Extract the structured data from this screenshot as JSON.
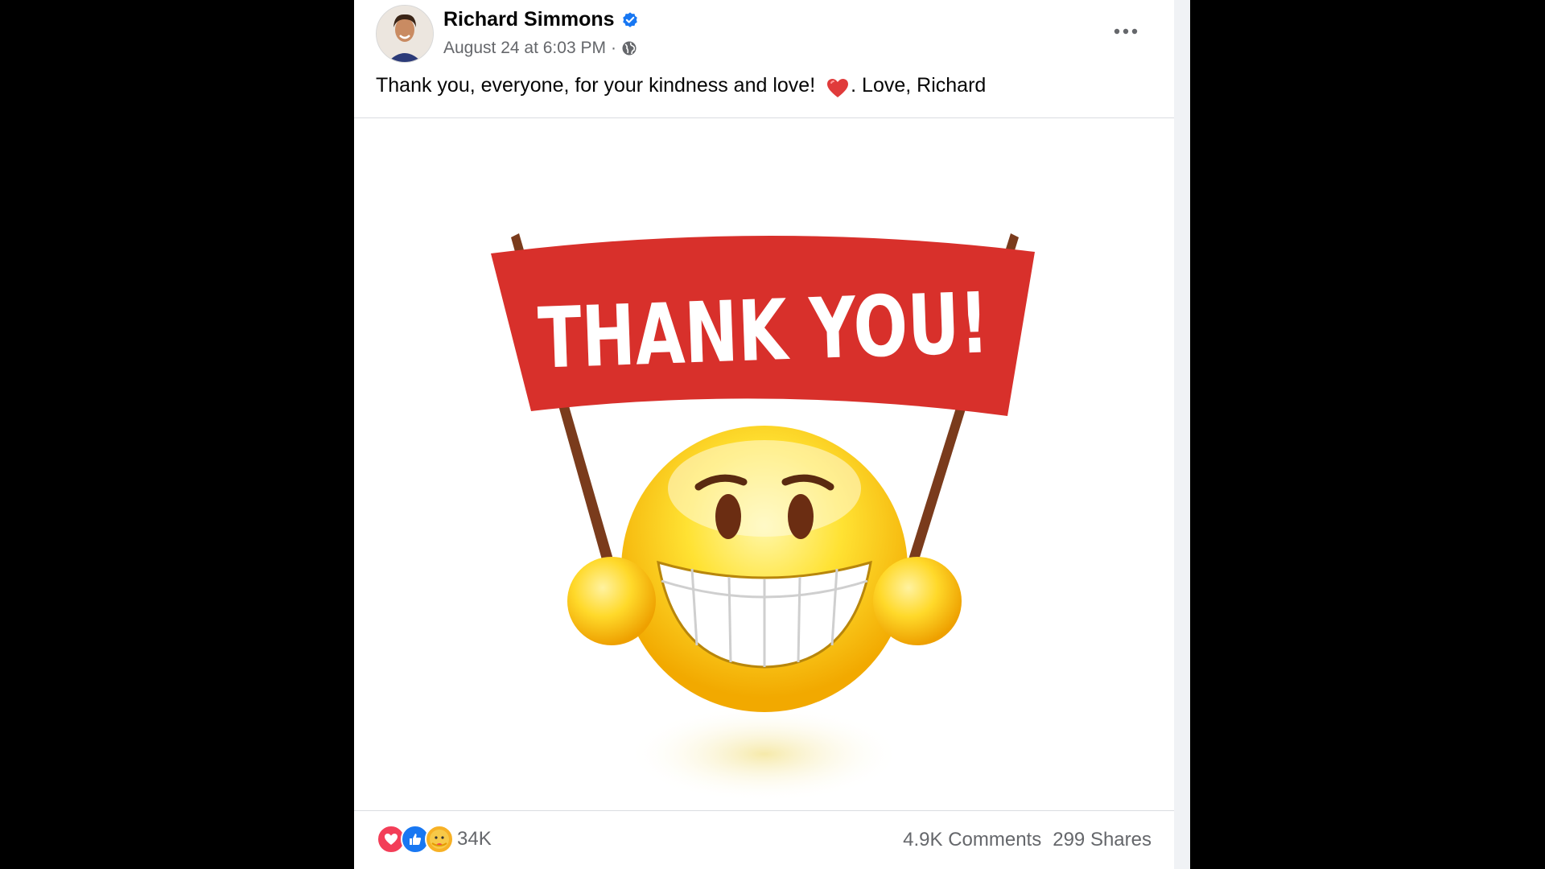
{
  "post": {
    "author": "Richard Simmons",
    "timestamp": "August 24 at 6:03 PM",
    "separator": "·",
    "caption_before": "Thank you, everyone, for your kindness and love!",
    "caption_after": ". Love, Richard",
    "banner_text": "THANK YOU!",
    "reaction_count": "34K",
    "comments": "4.9K Comments",
    "shares": "299 Shares",
    "reaction_icons": [
      "love-icon",
      "like-icon",
      "care-icon"
    ]
  },
  "colors": {
    "banner_red": "#d8302b",
    "verified_blue": "#1877f2",
    "smiley_yellow": "#ffd21f"
  }
}
